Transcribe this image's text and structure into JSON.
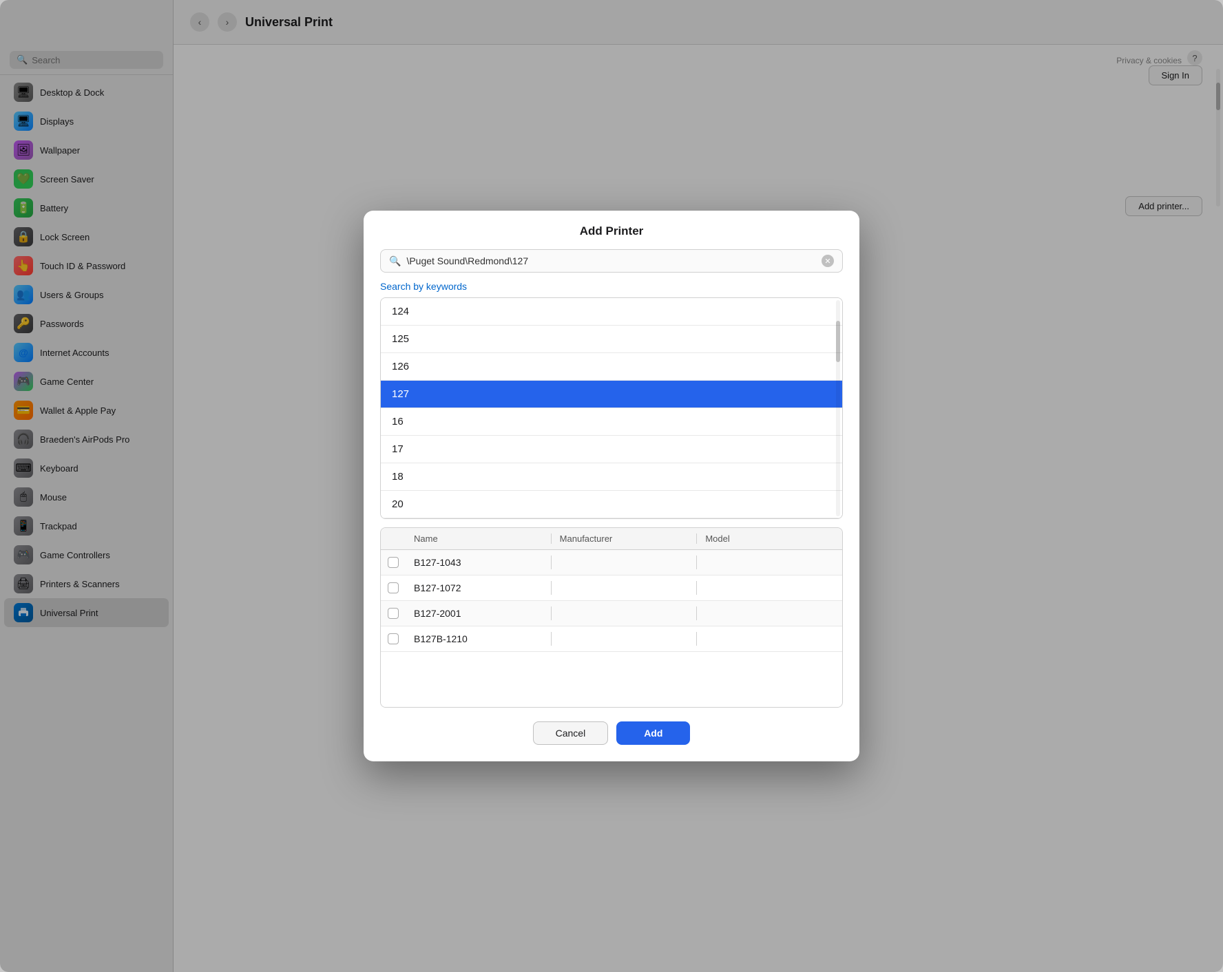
{
  "app": {
    "title": "Universal Print"
  },
  "window": {
    "traffic_lights": {
      "close": "close",
      "minimize": "minimize",
      "maximize": "maximize"
    }
  },
  "sidebar": {
    "search_placeholder": "Search",
    "items": [
      {
        "id": "desktop-dock",
        "label": "Desktop & Dock",
        "icon": "🖥"
      },
      {
        "id": "displays",
        "label": "Displays",
        "icon": "🖥"
      },
      {
        "id": "wallpaper",
        "label": "Wallpaper",
        "icon": "🎨"
      },
      {
        "id": "screen-saver",
        "label": "Screen Saver",
        "icon": "💚"
      },
      {
        "id": "battery",
        "label": "Battery",
        "icon": "🔋"
      },
      {
        "id": "lock-screen",
        "label": "Lock Screen",
        "icon": "🔒"
      },
      {
        "id": "touch-id",
        "label": "Touch ID & Password",
        "icon": "👆"
      },
      {
        "id": "users-groups",
        "label": "Users & Groups",
        "icon": "👥"
      },
      {
        "id": "passwords",
        "label": "Passwords",
        "icon": "🔑"
      },
      {
        "id": "internet-accounts",
        "label": "Internet Accounts",
        "icon": "@"
      },
      {
        "id": "game-center",
        "label": "Game Center",
        "icon": "🎮"
      },
      {
        "id": "wallet",
        "label": "Wallet & Apple Pay",
        "icon": "💳"
      },
      {
        "id": "airpods",
        "label": "Braeden's AirPods Pro",
        "icon": "🎧"
      },
      {
        "id": "keyboard",
        "label": "Keyboard",
        "icon": "⌨"
      },
      {
        "id": "mouse",
        "label": "Mouse",
        "icon": "🖱"
      },
      {
        "id": "trackpad",
        "label": "Trackpad",
        "icon": "📱"
      },
      {
        "id": "game-controllers",
        "label": "Game Controllers",
        "icon": "🎮"
      },
      {
        "id": "printers-scanners",
        "label": "Printers & Scanners",
        "icon": "🖨"
      },
      {
        "id": "universal-print",
        "label": "Universal Print",
        "icon": "🖨"
      }
    ]
  },
  "topbar": {
    "title": "Universal Print",
    "back_label": "‹",
    "forward_label": "›"
  },
  "main": {
    "sign_in_label": "Sign In",
    "add_printer_label": "Add printer...",
    "privacy_cookies_label": "Privacy & cookies",
    "help_label": "?"
  },
  "modal": {
    "title": "Add Printer",
    "search_value": "\\Puget Sound\\Redmond\\127",
    "search_placeholder": "\\Puget Sound\\Redmond\\127",
    "search_by_keywords_label": "Search by keywords",
    "results": [
      {
        "value": "124",
        "selected": false
      },
      {
        "value": "125",
        "selected": false
      },
      {
        "value": "126",
        "selected": false
      },
      {
        "value": "127",
        "selected": true
      },
      {
        "value": "16",
        "selected": false
      },
      {
        "value": "17",
        "selected": false
      },
      {
        "value": "18",
        "selected": false
      },
      {
        "value": "20",
        "selected": false
      }
    ],
    "table": {
      "columns": [
        {
          "id": "check",
          "label": ""
        },
        {
          "id": "name",
          "label": "Name"
        },
        {
          "id": "manufacturer",
          "label": "Manufacturer"
        },
        {
          "id": "model",
          "label": "Model"
        }
      ],
      "rows": [
        {
          "name": "B127-1043",
          "manufacturer": "",
          "model": ""
        },
        {
          "name": "B127-1072",
          "manufacturer": "",
          "model": ""
        },
        {
          "name": "B127-2001",
          "manufacturer": "",
          "model": ""
        },
        {
          "name": "B127B-1210",
          "manufacturer": "",
          "model": ""
        }
      ]
    },
    "cancel_label": "Cancel",
    "add_label": "Add"
  },
  "colors": {
    "accent": "#2563eb",
    "selected_row": "#2563eb",
    "link": "#0066cc"
  }
}
